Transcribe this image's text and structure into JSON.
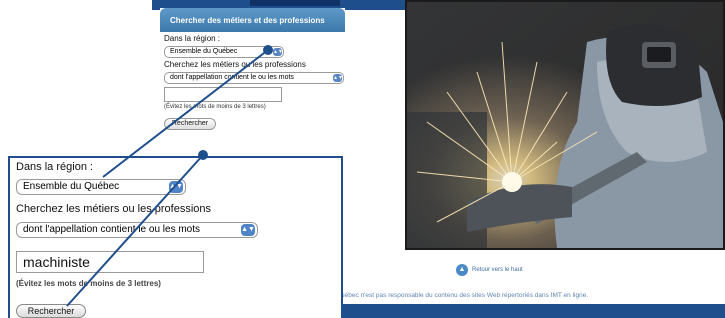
{
  "search_panel": {
    "title": "Chercher des métiers et des professions",
    "region_label": "Dans la région :",
    "region_value": "Ensemble du Québec",
    "search_label": "Cherchez les métiers ou les professions",
    "mode_value": "dont l'appellation contient le ou les mots",
    "hint": "(Évitez les mots de moins de 3 lettres)",
    "search_button": "Rechercher"
  },
  "zoom_panel": {
    "region_label": "Dans la région :",
    "region_value": "Ensemble du Québec",
    "search_label": "Cherchez les métiers ou les professions",
    "mode_value": "dont l'appellation contient le ou les mots",
    "keyword_value": "machiniste",
    "hint": "(Évitez les mots de moins de 3 lettres)",
    "search_button": "Rechercher"
  },
  "footer": {
    "back_to_top": "Retour vers le haut",
    "disclaimer": "Québec n'est pas responsable du contenu des sites Web répertoriés dans IMT en ligne."
  },
  "icons": {
    "stepper": "updown-arrows-icon",
    "back_to_top": "up-arrow-circle-icon"
  },
  "colors": {
    "brand_blue": "#1f4e8c",
    "header_blue": "#4a86bb",
    "callout_line": "#1f4e8c"
  }
}
